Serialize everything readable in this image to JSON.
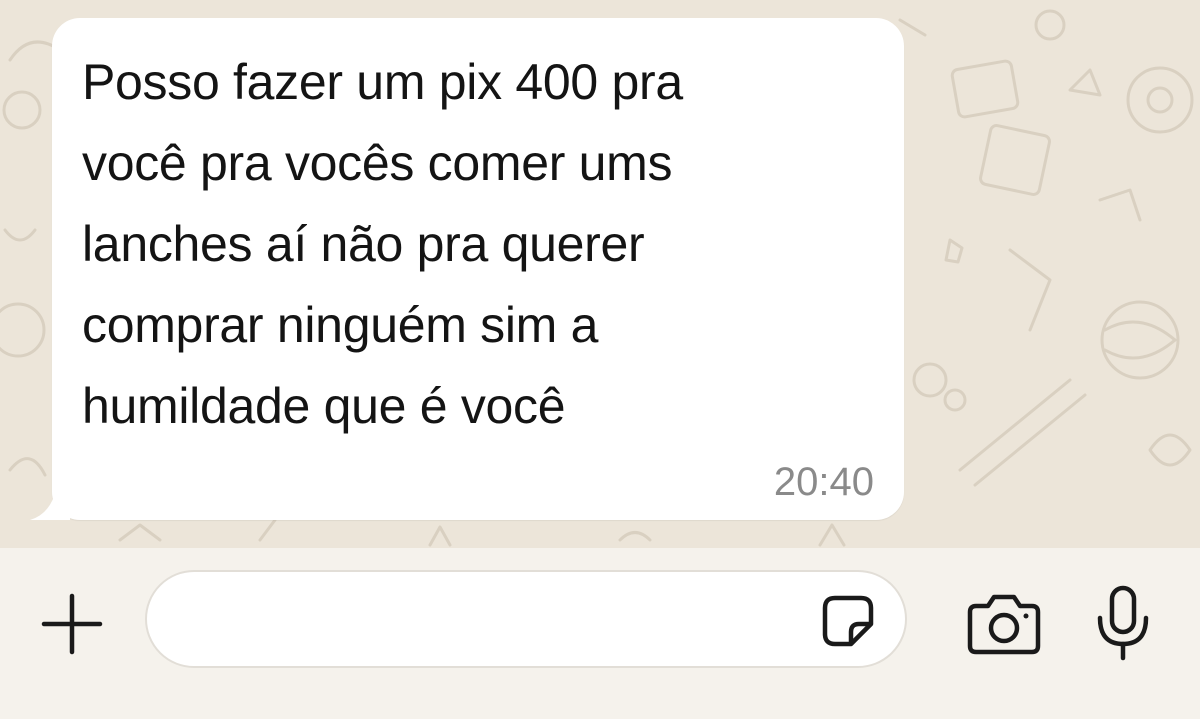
{
  "conversation": {
    "message": {
      "text": "Posso fazer um pix 400  pra\nvocê pra vocês comer ums\nlanches  aí não pra querer\ncomprar  ninguém sim a\nhumildade que é você",
      "time": "20:40"
    }
  },
  "composer": {
    "input_value": "",
    "icons": {
      "attach": "plus-icon",
      "sticker": "sticker-icon",
      "camera": "camera-icon",
      "microphone": "microphone-icon"
    }
  },
  "colors": {
    "chat_background": "#ece5d9",
    "bubble": "#ffffff",
    "message_text": "#141414",
    "timestamp": "#8a8a8a",
    "composer_background": "#f5f2ec",
    "icon": "#1a1a1a"
  }
}
